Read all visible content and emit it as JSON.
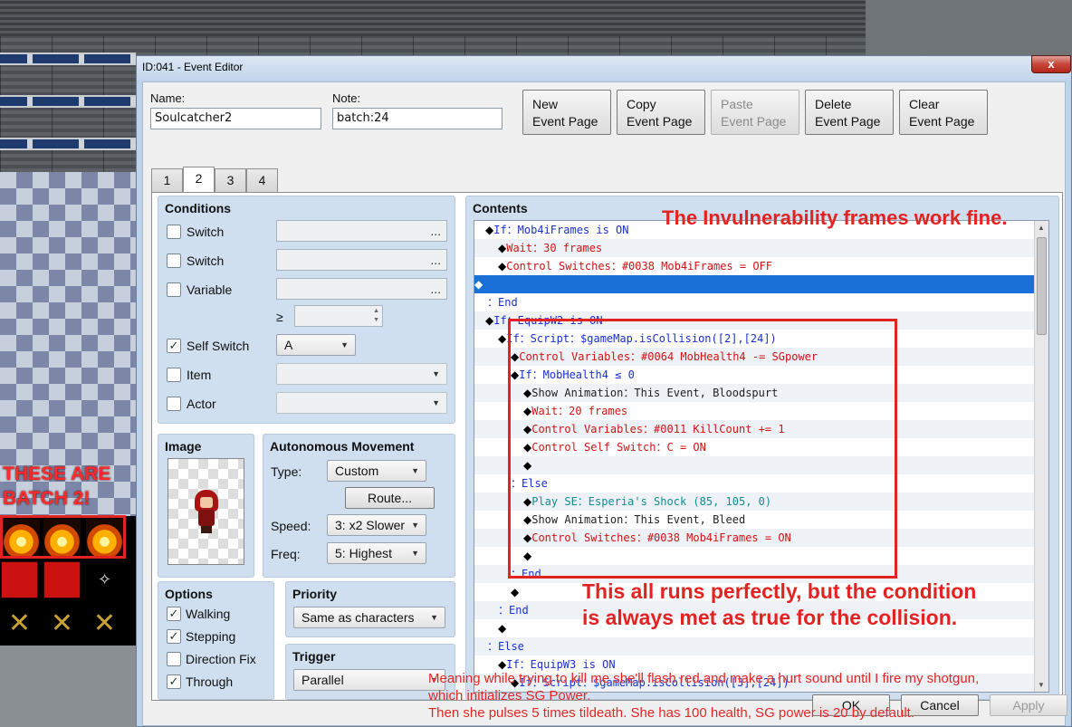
{
  "window": {
    "title": "ID:041 - Event Editor",
    "close_glyph": "x"
  },
  "name_field": {
    "label": "Name:",
    "value": "Soulcatcher2"
  },
  "note_field": {
    "label": "Note:",
    "value": "batch:24"
  },
  "toolbar": {
    "new_line1": "New",
    "new_line2": "Event Page",
    "copy_line1": "Copy",
    "copy_line2": "Event Page",
    "paste_line1": "Paste",
    "paste_line2": "Event Page",
    "delete_line1": "Delete",
    "delete_line2": "Event Page",
    "clear_line1": "Clear",
    "clear_line2": "Event Page"
  },
  "tabs": [
    {
      "label": "1"
    },
    {
      "label": "2"
    },
    {
      "label": "3"
    },
    {
      "label": "4"
    }
  ],
  "conditions": {
    "title": "Conditions",
    "switch1_label": "Switch",
    "switch2_label": "Switch",
    "variable_label": "Variable",
    "ge_symbol": "≥",
    "self_switch_label": "Self Switch",
    "self_switch_value": "A",
    "item_label": "Item",
    "actor_label": "Actor",
    "ellipsis": "...",
    "check_mark": "✓"
  },
  "image": {
    "title": "Image"
  },
  "autonomous": {
    "title": "Autonomous Movement",
    "type_label": "Type:",
    "type_value": "Custom",
    "route_label": "Route...",
    "speed_label": "Speed:",
    "speed_value": "3: x2 Slower",
    "freq_label": "Freq:",
    "freq_value": "5: Highest"
  },
  "options": {
    "title": "Options",
    "walking": "Walking",
    "stepping": "Stepping",
    "direction_fix": "Direction Fix",
    "through": "Through"
  },
  "priority": {
    "title": "Priority",
    "value": "Same as characters"
  },
  "trigger": {
    "title": "Trigger",
    "value": "Parallel"
  },
  "contents": {
    "title": "Contents",
    "rows": [
      {
        "prefix": "◆",
        "kw": "If：",
        "text": "Mob4iFrames is ON",
        "color": "blue"
      },
      {
        "prefix": "◆",
        "kw": "Wait：",
        "text": "30 frames",
        "color": "red"
      },
      {
        "prefix": "◆",
        "kw": "Control Switches：",
        "text": "#0038 Mob4iFrames = OFF",
        "color": "red"
      },
      {
        "prefix": "◆",
        "kw": "",
        "text": "",
        "color": "dark"
      },
      {
        "prefix": "",
        "kw": "：End",
        "text": "",
        "color": "blue"
      },
      {
        "prefix": "◆",
        "kw": "If：",
        "text": "EquipW2 is ON",
        "color": "blue"
      },
      {
        "prefix": "◆",
        "kw": "If：",
        "text": "Script：$gameMap.isCollision([2],[24])",
        "color": "blue"
      },
      {
        "prefix": "◆",
        "kw": "Control Variables：",
        "text": "#0064 MobHealth4 -= SGpower",
        "color": "red"
      },
      {
        "prefix": "◆",
        "kw": "If：",
        "text": "MobHealth4 ≤ 0",
        "color": "blue"
      },
      {
        "prefix": "◆",
        "kw": "Show Animation：",
        "text": "This Event, Bloodspurt",
        "color": "dark"
      },
      {
        "prefix": "◆",
        "kw": "Wait：",
        "text": "20 frames",
        "color": "red"
      },
      {
        "prefix": "◆",
        "kw": "Control Variables：",
        "text": "#0011 KillCount += 1",
        "color": "red"
      },
      {
        "prefix": "◆",
        "kw": "Control Self Switch：",
        "text": "C = ON",
        "color": "red"
      },
      {
        "prefix": "◆",
        "kw": "",
        "text": "",
        "color": "dark"
      },
      {
        "prefix": "",
        "kw": "：Else",
        "text": "",
        "color": "blue"
      },
      {
        "prefix": "◆",
        "kw": "Play SE：",
        "text": "Esperia's Shock (85, 105, 0)",
        "color": "teal"
      },
      {
        "prefix": "◆",
        "kw": "Show Animation：",
        "text": "This Event, Bleed",
        "color": "dark"
      },
      {
        "prefix": "◆",
        "kw": "Control Switches：",
        "text": "#0038 Mob4iFrames = ON",
        "color": "red"
      },
      {
        "prefix": "◆",
        "kw": "",
        "text": "",
        "color": "dark"
      },
      {
        "prefix": "",
        "kw": "：End",
        "text": "",
        "color": "blue"
      },
      {
        "prefix": "◆",
        "kw": "",
        "text": "",
        "color": "dark"
      },
      {
        "prefix": "",
        "kw": "：End",
        "text": "",
        "color": "blue"
      },
      {
        "prefix": "◆",
        "kw": "",
        "text": "",
        "color": "dark"
      },
      {
        "prefix": "",
        "kw": "：Else",
        "text": "",
        "color": "blue"
      },
      {
        "prefix": "◆",
        "kw": "If：",
        "text": "EquipW3 is ON",
        "color": "blue"
      },
      {
        "prefix": "◆",
        "kw": "If：",
        "text": "Script：$gameMap.isCollision([3],[24])",
        "color": "blue"
      }
    ]
  },
  "annotations": {
    "iframes": "The Invulnerability frames work fine.",
    "runs_line1": "This all runs perfectly, but the condition",
    "runs_line2": "is always met as true for the collision.",
    "batch_line1": "THESE ARE",
    "batch_line2": "BATCH 2!",
    "foot_line1": "Meaning while trying to kill me she'll flash red and make a hurt sound until I fire my shotgun,",
    "foot_line2": "which initializes SG Power.",
    "foot_line3": "Then she pulses 5 times tildeath. She has 100 health, SG power is 20 by default."
  },
  "footer": {
    "ok": "OK",
    "cancel": "Cancel",
    "apply": "Apply"
  },
  "colors": {
    "blue": "#1a2fd0",
    "red": "#d21212",
    "teal": "#0f8c8c",
    "selection": "#1a70d6",
    "annotation": "#e32222"
  },
  "icons": {
    "close": "close-icon",
    "dropdown": "chevron-down-icon",
    "check": "check-icon"
  }
}
